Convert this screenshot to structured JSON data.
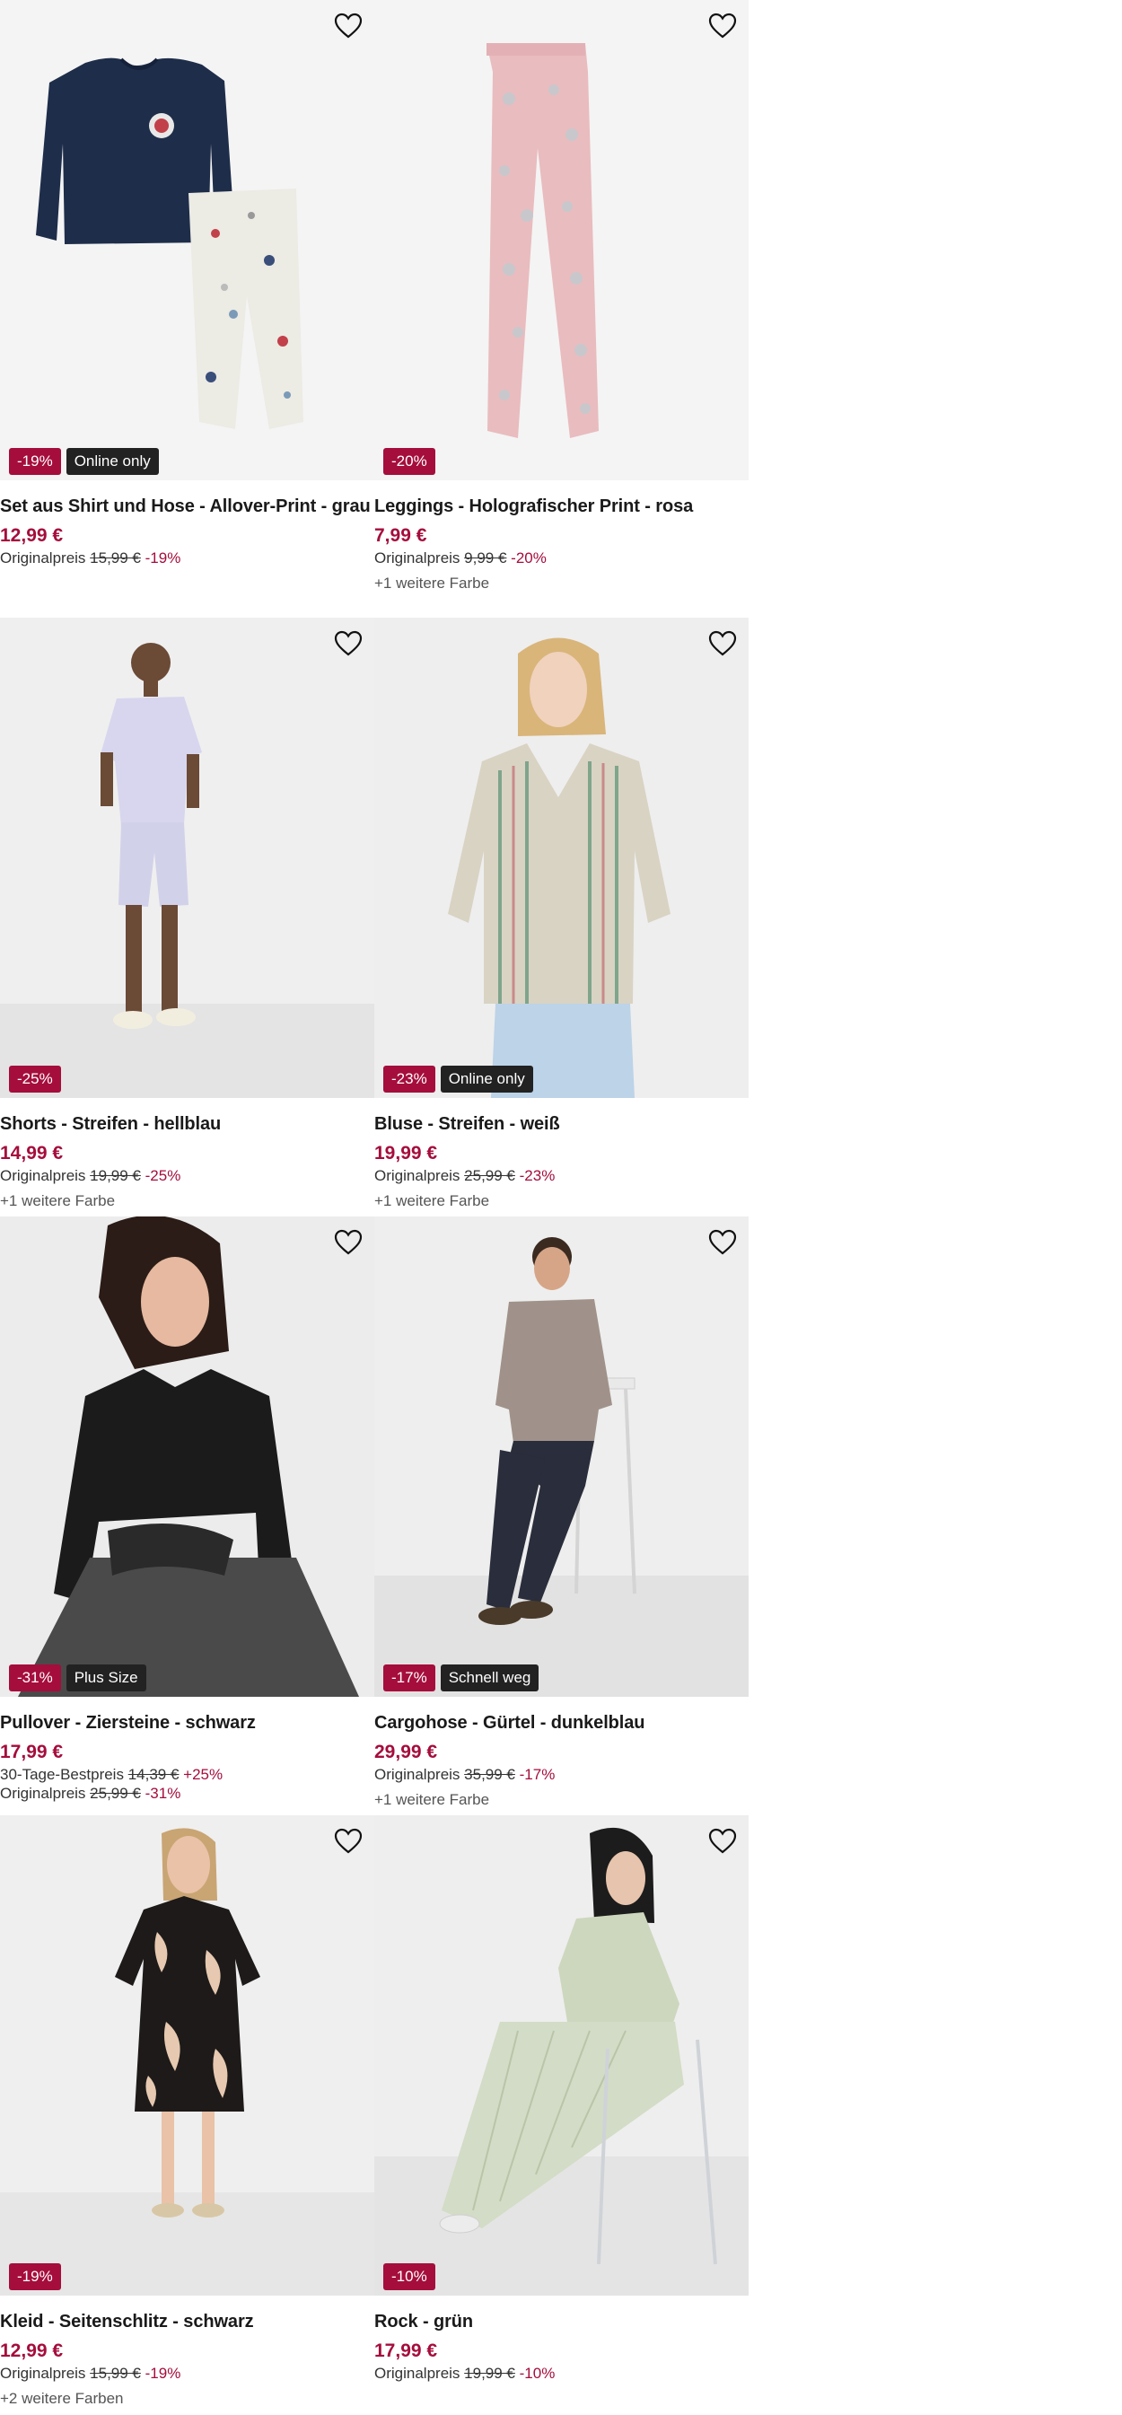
{
  "products": [
    {
      "title": "Set aus Shirt und Hose - Allover-Print - grau",
      "price": "12,99 €",
      "badges": [
        "-19%",
        "Online only"
      ],
      "lines": [
        {
          "label": "Originalpreis",
          "old": "15,99 €",
          "pct": "-19%"
        }
      ],
      "more": ""
    },
    {
      "title": "Leggings - Holografischer Print - rosa",
      "price": "7,99 €",
      "badges": [
        "-20%"
      ],
      "lines": [
        {
          "label": "Originalpreis",
          "old": "9,99 €",
          "pct": "-20%"
        }
      ],
      "more": "+1 weitere Farbe"
    },
    {
      "title": "Shorts - Streifen - hellblau",
      "price": "14,99 €",
      "badges": [
        "-25%"
      ],
      "lines": [
        {
          "label": "Originalpreis",
          "old": "19,99 €",
          "pct": "-25%"
        }
      ],
      "more": "+1 weitere Farbe"
    },
    {
      "title": "Bluse - Streifen - weiß",
      "price": "19,99 €",
      "badges": [
        "-23%",
        "Online only"
      ],
      "lines": [
        {
          "label": "Originalpreis",
          "old": "25,99 €",
          "pct": "-23%"
        }
      ],
      "more": "+1 weitere Farbe"
    },
    {
      "title": "Pullover - Ziersteine - schwarz",
      "price": "17,99 €",
      "badges": [
        "-31%",
        "Plus Size"
      ],
      "lines": [
        {
          "label": "30-Tage-Bestpreis",
          "old": "14,39 €",
          "pct": "+25%"
        },
        {
          "label": "Originalpreis",
          "old": "25,99 €",
          "pct": "-31%"
        }
      ],
      "more": ""
    },
    {
      "title": "Cargohose - Gürtel - dunkelblau",
      "price": "29,99 €",
      "badges": [
        "-17%",
        "Schnell weg"
      ],
      "lines": [
        {
          "label": "Originalpreis",
          "old": "35,99 €",
          "pct": "-17%"
        }
      ],
      "more": "+1 weitere Farbe"
    },
    {
      "title": "Kleid - Seitenschlitz - schwarz",
      "price": "12,99 €",
      "badges": [
        "-19%"
      ],
      "lines": [
        {
          "label": "Originalpreis",
          "old": "15,99 €",
          "pct": "-19%"
        }
      ],
      "more": "+2 weitere Farben"
    },
    {
      "title": "Rock - grün",
      "price": "17,99 €",
      "badges": [
        "-10%"
      ],
      "lines": [
        {
          "label": "Originalpreis",
          "old": "19,99 €",
          "pct": "-10%"
        }
      ],
      "more": ""
    }
  ],
  "icons": {
    "wishlist": "heart-outline-icon"
  },
  "colors": {
    "sale": "#a50d3c",
    "dark_badge": "#222222",
    "text": "#1a1a1a"
  }
}
